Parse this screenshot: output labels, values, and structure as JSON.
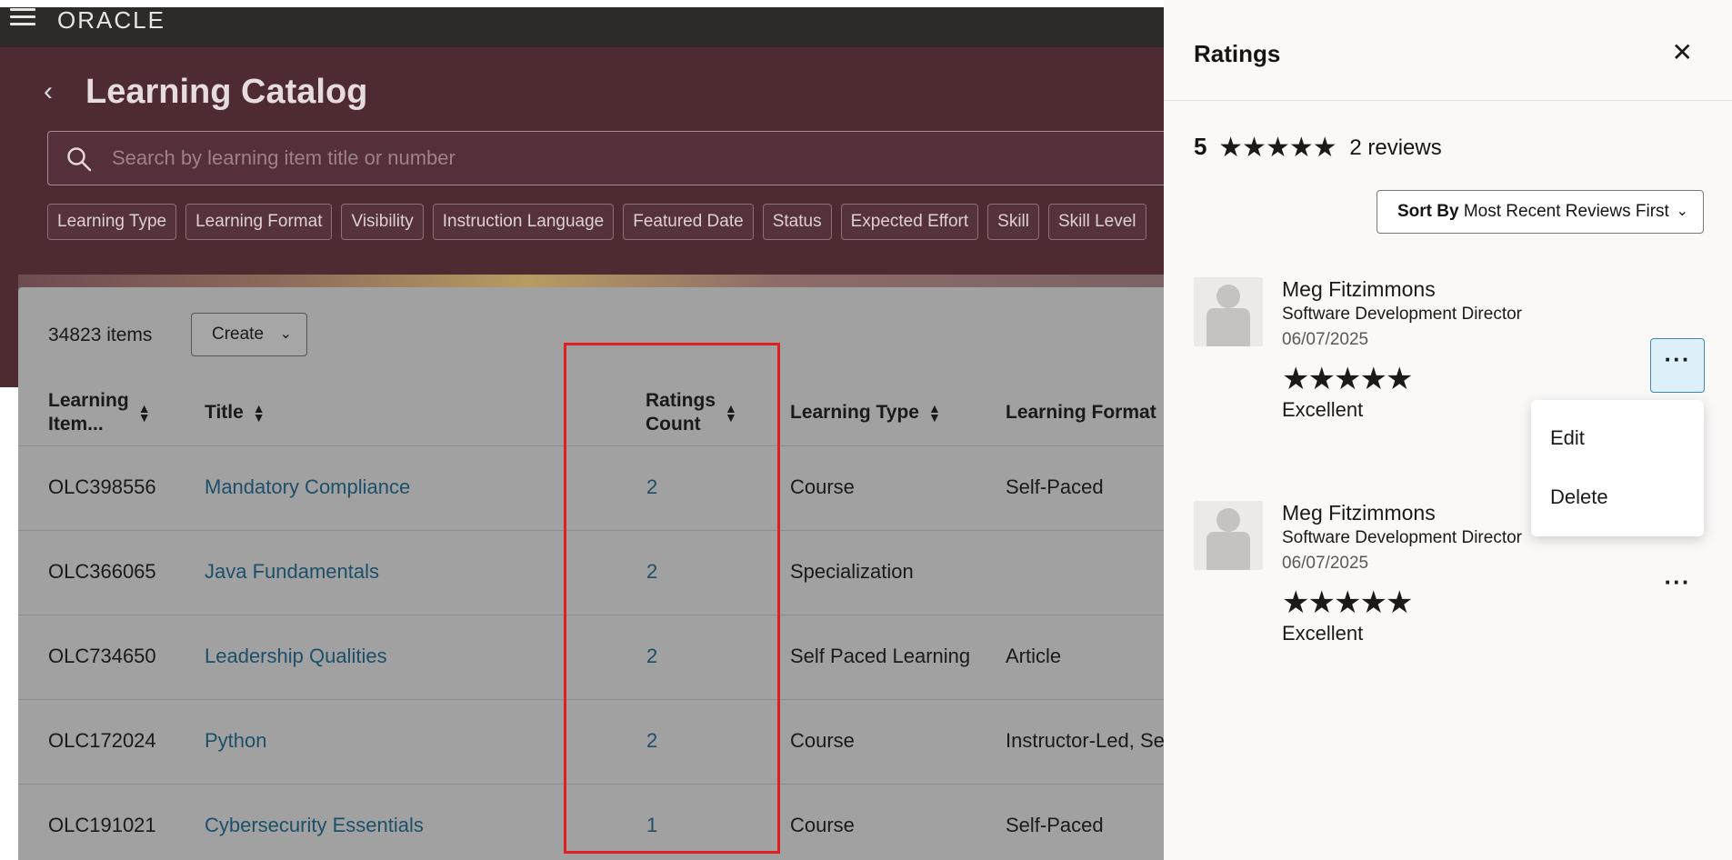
{
  "app": {
    "logo": "ORACLE"
  },
  "page": {
    "title": "Learning Catalog",
    "search_placeholder": "Search by learning item title or number",
    "filters": [
      "Learning Type",
      "Learning Format",
      "Visibility",
      "Instruction Language",
      "Featured Date",
      "Status",
      "Expected Effort",
      "Skill",
      "Skill Level"
    ]
  },
  "table": {
    "item_count": "34823 items",
    "create_label": "Create",
    "columns": {
      "number": [
        "Learning",
        "Item..."
      ],
      "title": "Title",
      "ratings": [
        "Ratings",
        "Count"
      ],
      "type": "Learning Type",
      "format": "Learning Format"
    },
    "rows": [
      {
        "number": "OLC398556",
        "title": "Mandatory Compliance",
        "ratings": "2",
        "type": "Course",
        "format": "Self-Paced"
      },
      {
        "number": "OLC366065",
        "title": "Java Fundamentals",
        "ratings": "2",
        "type": "Specialization",
        "format": ""
      },
      {
        "number": "OLC734650",
        "title": "Leadership Qualities",
        "ratings": "2",
        "type": "Self Paced Learning",
        "format": "Article"
      },
      {
        "number": "OLC172024",
        "title": "Python",
        "ratings": "2",
        "type": "Course",
        "format": "Instructor-Led, Se"
      },
      {
        "number": "OLC191021",
        "title": "Cybersecurity Essentials",
        "ratings": "1",
        "type": "Course",
        "format": "Self-Paced"
      }
    ]
  },
  "drawer": {
    "title": "Ratings",
    "summary": {
      "score": "5",
      "stars": 5,
      "reviews": "2 reviews"
    },
    "sort": {
      "prefix": "Sort By",
      "value": "Most Recent Reviews First"
    },
    "reviews": [
      {
        "name": "Meg Fitzimmons",
        "role": "Software Development Director",
        "date": "06/07/2025",
        "stars": 5,
        "label": "Excellent"
      },
      {
        "name": "Meg Fitzimmons",
        "role": "Software Development Director",
        "date": "06/07/2025",
        "stars": 5,
        "label": "Excellent"
      }
    ],
    "menu": {
      "edit": "Edit",
      "delete": "Delete"
    }
  },
  "icons": {
    "hamburger": "hamburger-icon",
    "back": "chevron-left-icon",
    "search": "search-icon",
    "sort": "sort-icon",
    "star": "star-icon",
    "close": "close-icon",
    "more": "more-horizontal-icon",
    "chevron_down": "chevron-down-icon"
  },
  "colors": {
    "hero": "#4e2a31",
    "link": "#1c4f6a",
    "highlight": "#e02020",
    "active_button": "#def0f9"
  }
}
